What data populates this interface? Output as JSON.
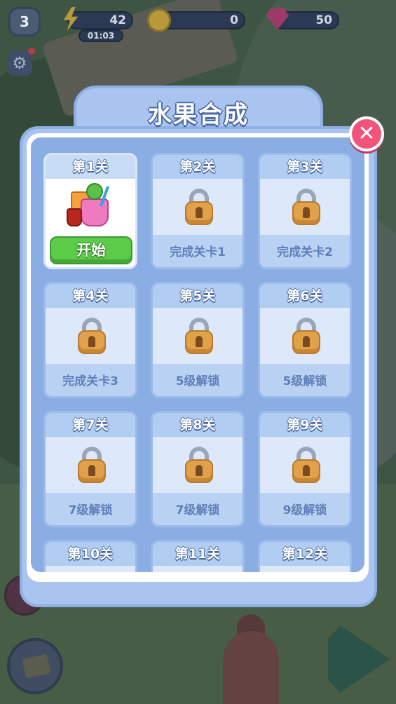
{
  "hud": {
    "player_level": "3",
    "energy": "42",
    "energy_timer": "01:03",
    "coins": "0",
    "gems": "50"
  },
  "dialog": {
    "title": "水果合成",
    "close_symbol": "✕",
    "levels": [
      {
        "title": "第1关",
        "status": "unlocked",
        "action": "开始"
      },
      {
        "title": "第2关",
        "status": "locked",
        "requirement": "完成关卡1"
      },
      {
        "title": "第3关",
        "status": "locked",
        "requirement": "完成关卡2"
      },
      {
        "title": "第4关",
        "status": "locked",
        "requirement": "完成关卡3"
      },
      {
        "title": "第5关",
        "status": "locked",
        "requirement": "5级解锁"
      },
      {
        "title": "第6关",
        "status": "locked",
        "requirement": "5级解锁"
      },
      {
        "title": "第7关",
        "status": "locked",
        "requirement": "7级解锁"
      },
      {
        "title": "第8关",
        "status": "locked",
        "requirement": "7级解锁"
      },
      {
        "title": "第9关",
        "status": "locked",
        "requirement": "9级解锁"
      },
      {
        "title": "第10关",
        "status": "locked",
        "requirement": ""
      },
      {
        "title": "第11关",
        "status": "locked",
        "requirement": ""
      },
      {
        "title": "第12关",
        "status": "locked",
        "requirement": ""
      }
    ]
  },
  "icons": {
    "energy": "lightning-icon",
    "coin": "coin-icon",
    "gem": "gem-icon",
    "settings": "gear-icon",
    "lock": "padlock-icon",
    "close": "close-icon",
    "level1_art": "fruit-drink-icon"
  },
  "colors": {
    "dialog_frame": "#a9c4ee",
    "close_button": "#f2537a",
    "start_button": "#5ccc48",
    "lock_body": "#e0a14a"
  }
}
